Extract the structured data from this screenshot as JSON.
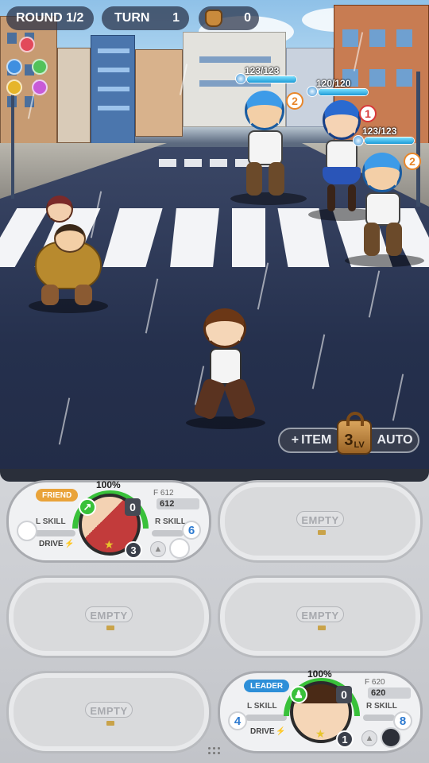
{
  "hud": {
    "round_label": "ROUND 1/2",
    "turn_label": "TURN",
    "turn_value": "1",
    "bag_icon": "bag-icon",
    "bag_count": "0"
  },
  "orbs": {
    "colors": [
      "#e24a5a",
      "#3f8fe0",
      "#52c25a",
      "#e6b52a",
      "#c85ad8"
    ]
  },
  "enemies": [
    {
      "hp": "123/123",
      "hp_fraction": 1,
      "turn": "2",
      "turn_color": "#e8862a"
    },
    {
      "hp": "120/120",
      "hp_fraction": 1,
      "turn": "1",
      "turn_color": "#d83a3a"
    },
    {
      "hp": "123/123",
      "hp_fraction": 1,
      "turn": "2",
      "turn_color": "#e8862a"
    }
  ],
  "actions": {
    "item_label": "ITEM",
    "lock_level": "3",
    "lock_level_suffix": "LV",
    "auto_label": "AUTO"
  },
  "cards": {
    "friend": {
      "tag": "FRIEND",
      "gauge_percent": "100%",
      "f_label": "F 612",
      "f_value": "612",
      "l_skill": "L SKILL",
      "r_skill": "R SKILL",
      "drive": "DRIVE",
      "count": "0",
      "r_skill_num": "6",
      "level": "3",
      "level_star": "★"
    },
    "leader": {
      "tag": "LEADER",
      "gauge_percent": "100%",
      "f_label": "F 620",
      "f_value": "620",
      "l_skill": "L SKILL",
      "r_skill": "R SKILL",
      "drive": "DRIVE",
      "count": "0",
      "l_skill_num": "4",
      "r_skill_num": "8",
      "level": "1",
      "level_star": "★"
    }
  },
  "empty_label": "EMPTY",
  "accent_green": "#39c13a",
  "accent_blue": "#2d8fd8"
}
